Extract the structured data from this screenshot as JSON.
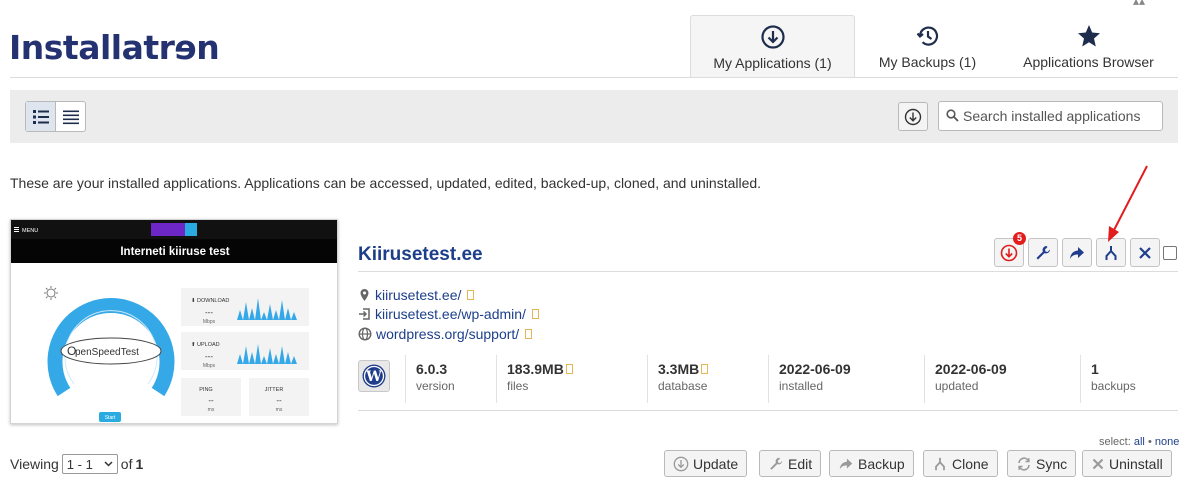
{
  "header": {
    "logo": "Installatrɘn",
    "tabs": [
      {
        "label": "My Applications (1)",
        "icon": "download-circle-icon"
      },
      {
        "label": "My Backups (1)",
        "icon": "history-clock-icon"
      },
      {
        "label": "Applications Browser",
        "icon": "star-icon"
      }
    ]
  },
  "toolbar": {
    "search_placeholder": "Search installed applications"
  },
  "intro": "These are your installed applications. Applications can be accessed, updated, edited, backed-up, cloned, and uninstalled.",
  "app": {
    "title": "Kiirusetest.ee",
    "update_badge": "5",
    "links": [
      {
        "icon": "map-pin-icon",
        "text": "kiirusetest.ee/"
      },
      {
        "icon": "login-icon",
        "text": "kiirusetest.ee/wp-admin/"
      },
      {
        "icon": "globe-icon",
        "text": "wordpress.org/support/"
      }
    ],
    "stats": [
      {
        "value": "6.0.3",
        "label": "version"
      },
      {
        "value": "183.9MB",
        "label": "files"
      },
      {
        "value": "3.3MB",
        "label": "database"
      },
      {
        "value": "2022-06-09",
        "label": "installed"
      },
      {
        "value": "2022-06-09",
        "label": "updated"
      },
      {
        "value": "1",
        "label": "backups"
      }
    ],
    "thumbnail": {
      "menu": "MENU",
      "heading": "Interneti kiiruse test",
      "brand": "penSpeedTest",
      "download_label": "DOWNLOAD",
      "upload_label": "UPLOAD",
      "ping_label": "PING",
      "jitter_label": "JITTER",
      "dashes": "---",
      "unit_mbps": "Mbps",
      "unit_ms": "ms",
      "ping_value": "--",
      "jitter_value": "--",
      "start_label": "Start"
    }
  },
  "select": {
    "prefix": "select:",
    "all": "all",
    "separator": "•",
    "none": "none"
  },
  "footer": {
    "viewing_prefix": "Viewing",
    "page_range": "1 - 1",
    "of_label": "of",
    "total": "1",
    "buttons": {
      "update": "Update",
      "edit": "Edit",
      "backup": "Backup",
      "clone": "Clone",
      "sync": "Sync",
      "uninstall": "Uninstall"
    }
  },
  "colors": {
    "brand": "#243272",
    "link": "#1d3f8b",
    "badge": "#e21d1d",
    "arrow": "#e21d1d"
  }
}
